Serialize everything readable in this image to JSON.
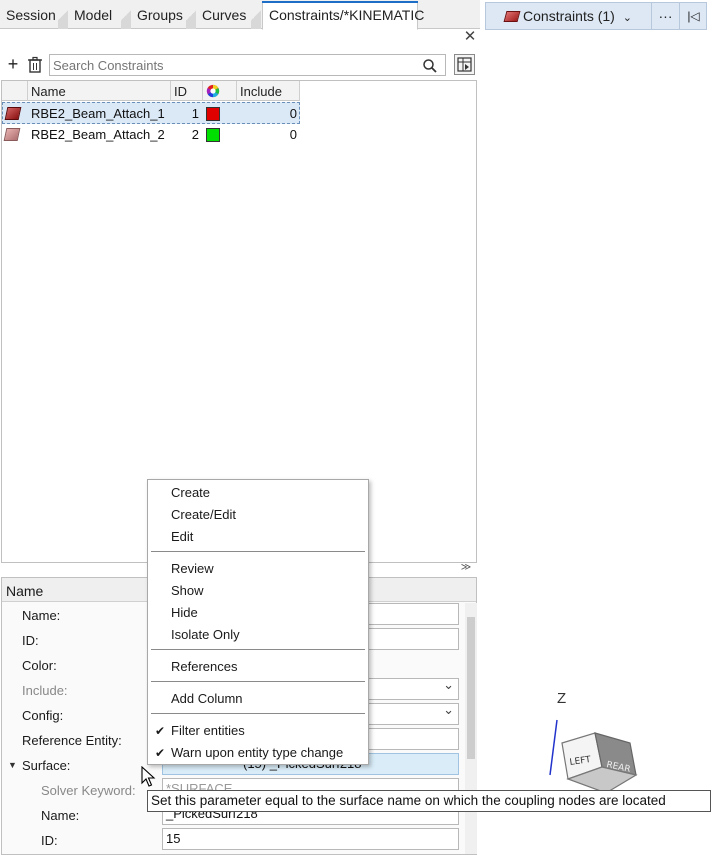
{
  "tabs": [
    {
      "label": "Session"
    },
    {
      "label": "Model"
    },
    {
      "label": "Groups"
    },
    {
      "label": "Curves"
    },
    {
      "label": "Constraints/*KINEMATIC"
    }
  ],
  "toolbar_right": {
    "entity_selector": "Constraints (1)",
    "more_label": "···",
    "collapse_label": "|◁"
  },
  "search": {
    "placeholder": "Search Constraints"
  },
  "table": {
    "columns": [
      "Name",
      "ID",
      "Include"
    ],
    "rows": [
      {
        "name": "RBE2_Beam_Attach_1",
        "id": "1",
        "color": "#e00000",
        "include": "0",
        "selected": true
      },
      {
        "name": "RBE2_Beam_Attach_2",
        "id": "2",
        "color": "#00e000",
        "include": "0",
        "selected": false
      }
    ]
  },
  "properties": {
    "header": "Name",
    "fields": [
      {
        "label": "Name:",
        "value": ""
      },
      {
        "label": "ID:",
        "value": ""
      },
      {
        "label": "Color:",
        "value": ""
      },
      {
        "label": "Include:",
        "value": ""
      },
      {
        "label": "Config:",
        "value": ""
      },
      {
        "label": "Reference Entity:",
        "value": ""
      },
      {
        "label": "Surface:",
        "value": "(15) _PickedSurf218"
      },
      {
        "label": "Solver Keyword:",
        "value": "*SURFACE"
      },
      {
        "label": "Name:",
        "value": "_PickedSurf218"
      },
      {
        "label": "ID:",
        "value": "15"
      }
    ]
  },
  "context_menu": {
    "items": [
      "Create",
      "Create/Edit",
      "Edit",
      "Review",
      "Show",
      "Hide",
      "Isolate Only",
      "References",
      "Add Column",
      "Filter entities",
      "Warn upon entity type change"
    ]
  },
  "tooltip": "Set this parameter equal to the surface name on which the coupling nodes are located",
  "viewcube": {
    "axis_label": "Z",
    "face_left": "LEFT",
    "face_rear": "REAR"
  }
}
